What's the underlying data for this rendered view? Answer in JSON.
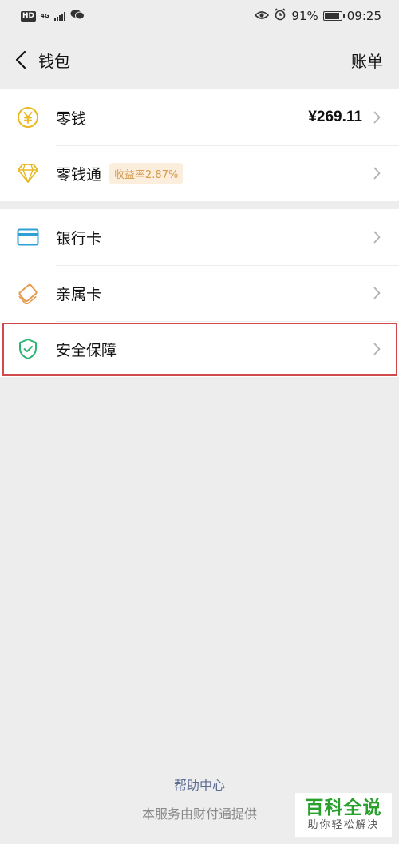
{
  "status_bar": {
    "hd": "HD",
    "network": "4G",
    "battery_percent": "91%",
    "time": "09:25",
    "icons": [
      "hd-icon",
      "signal-icon",
      "wechat-icon",
      "eye-icon",
      "alarm-icon",
      "battery-icon"
    ]
  },
  "nav": {
    "title": "钱包",
    "right_label": "账单",
    "back_icon": "chevron-left-icon"
  },
  "wallet": {
    "items": [
      {
        "label": "零钱",
        "value": "¥269.11",
        "icon": "yuan-coin-icon"
      },
      {
        "label": "零钱通",
        "badge": "收益率2.87%",
        "icon": "diamond-icon"
      }
    ]
  },
  "cards": {
    "items": [
      {
        "label": "银行卡",
        "icon": "bank-card-icon"
      },
      {
        "label": "亲属卡",
        "icon": "family-card-icon"
      },
      {
        "label": "安全保障",
        "icon": "shield-icon"
      }
    ]
  },
  "footer": {
    "help": "帮助中心",
    "provider": "本服务由财付通提供"
  },
  "watermark": {
    "title": "百科全说",
    "subtitle": "助你轻松解决"
  },
  "colors": {
    "background": "#ededed",
    "link": "#5b6d93",
    "coin": "#e8b923",
    "bank_card": "#2ea0d6",
    "family_card": "#e59a4d",
    "shield": "#2bb574",
    "highlight": "#d0494b"
  }
}
